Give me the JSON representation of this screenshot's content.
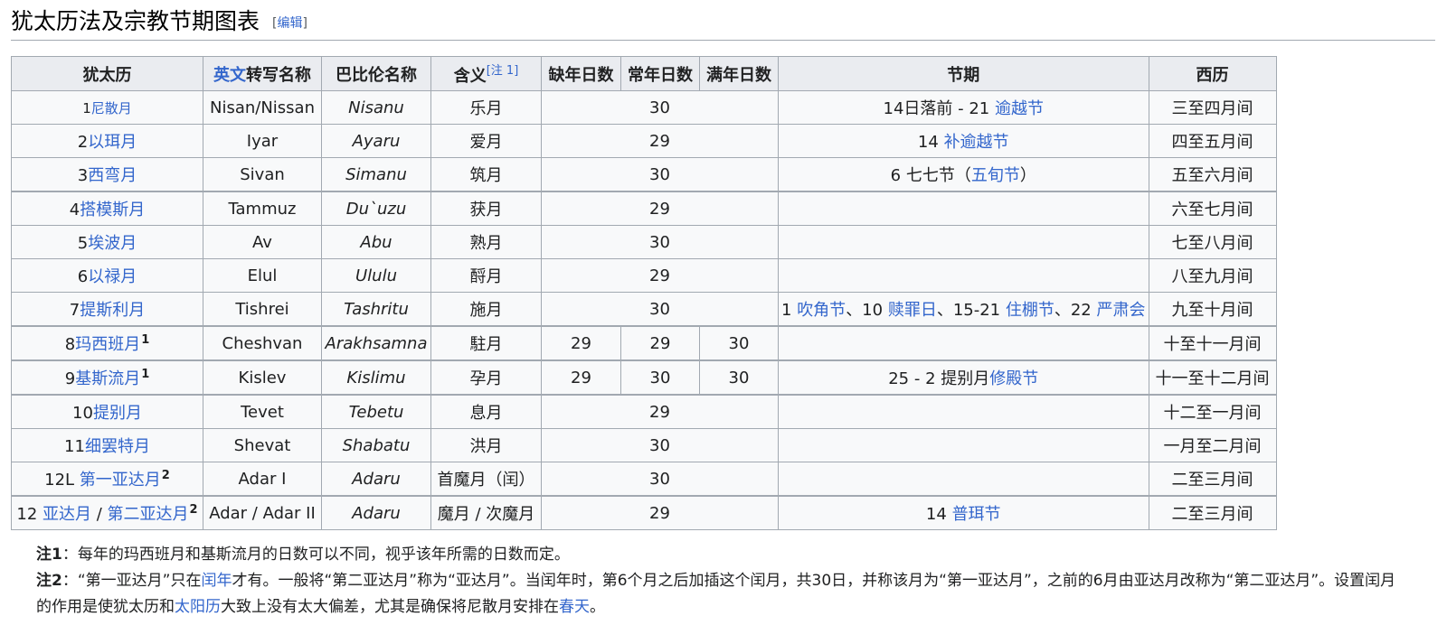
{
  "heading": {
    "title": "犹太历法及宗教节期图表",
    "edit_open": "[",
    "edit": "编辑",
    "edit_close": "]"
  },
  "table": {
    "headers": {
      "hebrew": "犹太历",
      "english_link": "英文",
      "english_rest": "转写名称",
      "babylonian": "巴比伦名称",
      "meaning": "含义",
      "meaning_note": "[注 1]",
      "deficient": "缺年日数",
      "regular": "常年日数",
      "complete": "满年日数",
      "festivals": "节期",
      "gregorian": "西历"
    },
    "rows": [
      {
        "num": "1",
        "name": "尼散月",
        "eng": "Nisan/Nissan",
        "bab": "Nisanu",
        "meaning": "乐月",
        "days": "30",
        "fest_pre": "14日落前 - 21 ",
        "fest_link": "逾越节",
        "greg": "三至四月间"
      },
      {
        "num": "2",
        "name": "以珥月",
        "eng": "Iyar",
        "bab": "Ayaru",
        "meaning": "爱月",
        "days": "29",
        "fest_pre": "14 ",
        "fest_link": "补逾越节",
        "greg": "四至五月间"
      },
      {
        "num": "3",
        "name": "西弯月",
        "eng": "Sivan",
        "bab": "Simanu",
        "meaning": "筑月",
        "days": "30",
        "fest_pre": "6 七七节（",
        "fest_link": "五旬节",
        "fest_post": "）",
        "greg": "五至六月间"
      },
      {
        "num": "4",
        "name": "搭模斯月",
        "eng": "Tammuz",
        "bab": "Du`uzu",
        "meaning": "获月",
        "days": "29",
        "greg": "六至七月间"
      },
      {
        "num": "5",
        "name": "埃波月",
        "eng": "Av",
        "bab": "Abu",
        "meaning": "熟月",
        "days": "30",
        "greg": "七至八月间"
      },
      {
        "num": "6",
        "name": "以禄月",
        "eng": "Elul",
        "bab": "Ululu",
        "meaning": "酹月",
        "days": "29",
        "greg": "八至九月间"
      },
      {
        "num": "7",
        "name": "提斯利月",
        "eng": "Tishrei",
        "bab": "Tashritu",
        "meaning": "施月",
        "days": "30",
        "fest": {
          "p1": "1 ",
          "l1": "吹角节",
          "p2": "、10 ",
          "l2": "赎罪日",
          "p3": "、15-21 ",
          "l3": "住棚节",
          "p4": "、22 ",
          "l4": "严肃会"
        },
        "greg": "九至十月间"
      },
      {
        "num": "8",
        "name": "玛西班月",
        "sup": "1",
        "eng": "Cheshvan",
        "bab": "Arakhsamna",
        "meaning": "駐月",
        "d1": "29",
        "d2": "29",
        "d3": "30",
        "greg": "十至十一月间"
      },
      {
        "num": "9",
        "name": "基斯流月",
        "sup": "1",
        "eng": "Kislev",
        "bab": "Kislimu",
        "meaning": "孕月",
        "d1": "29",
        "d2": "30",
        "d3": "30",
        "fest_pre": "25 - 2 提别月",
        "fest_link": "修殿节",
        "greg": "十一至十二月间"
      },
      {
        "num": "10",
        "name": "提别月",
        "eng": "Tevet",
        "bab": "Tebetu",
        "meaning": "息月",
        "days": "29",
        "greg": "十二至一月间"
      },
      {
        "num": "11",
        "name": "细罢特月",
        "eng": "Shevat",
        "bab": "Shabatu",
        "meaning": "洪月",
        "days": "30",
        "greg": "一月至二月间"
      },
      {
        "num": "12L ",
        "name": "第一亚达月",
        "sup": "2",
        "eng": "Adar I",
        "bab": "Adaru",
        "meaning": "首魔月（闰）",
        "days": "30",
        "greg": "二至三月间"
      },
      {
        "num": "12 ",
        "name": "亚达月",
        "sep": " / ",
        "name2": "第二亚达月",
        "sup": "2",
        "eng": "Adar / Adar II",
        "bab": "Adaru",
        "meaning": "魔月 / 次魔月",
        "days": "29",
        "fest_pre": "14 ",
        "fest_link": "普珥节",
        "greg": "二至三月间"
      }
    ]
  },
  "notes": {
    "n1_label": "注1",
    "n1_text": "：每年的玛西班月和基斯流月的日数可以不同，视乎该年所需的日数而定。",
    "n2_label": "注2",
    "n2_a": "：“第一亚达月”只在",
    "n2_link1": "闰年",
    "n2_b": "才有。一般将“第二亚达月”称为“亚达月”。当闰年时，第6个月之后加插这个闰月，共30日，并称该月为“第一亚达月”，之前的6月由亚达月改称为“第二亚达月”。设置闰月的作用是使犹太历和",
    "n2_link2": "太阳历",
    "n2_c": "大致上没有太大偏差，尤其是确保将尼散月安排在",
    "n2_link3": "春天",
    "n2_d": "。"
  }
}
